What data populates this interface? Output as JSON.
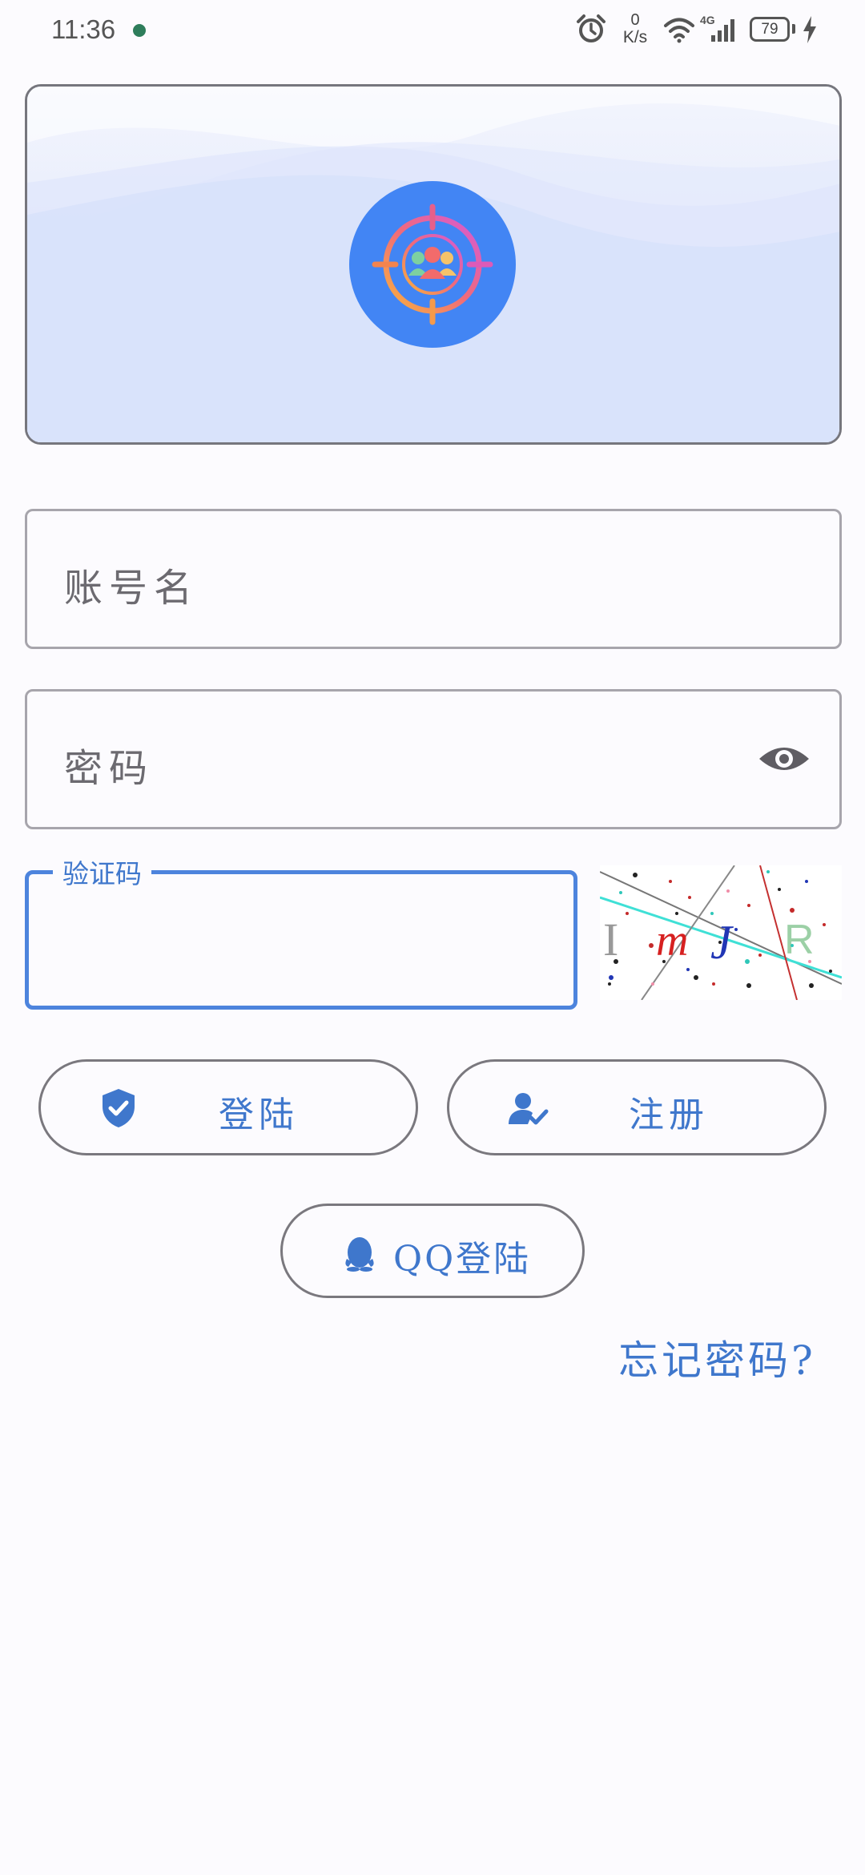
{
  "status_bar": {
    "time": "11:36",
    "net_speed_value": "0",
    "net_speed_unit": "K/s",
    "network_type": "4G",
    "battery_level": "79"
  },
  "form": {
    "username_placeholder": "账号名",
    "password_placeholder": "密码",
    "captcha_label": "验证码"
  },
  "buttons": {
    "login": "登陆",
    "register": "注册",
    "qq_login": "QQ登陆"
  },
  "links": {
    "forgot_password": "忘记密码?"
  },
  "colors": {
    "accent": "#3f77cc",
    "logo_circle": "#4285f4",
    "banner_bg": "#d8e2fb"
  },
  "icons": {
    "status_bar": [
      "notification-dot-icon",
      "alarm-icon",
      "wifi-icon",
      "cellular-signal-icon",
      "battery-icon",
      "charging-bolt-icon"
    ],
    "logo": "target-group-logo-icon",
    "password_toggle": "eye-icon",
    "login": "shield-check-icon",
    "register": "user-check-icon",
    "qq_login": "qq-penguin-icon"
  }
}
